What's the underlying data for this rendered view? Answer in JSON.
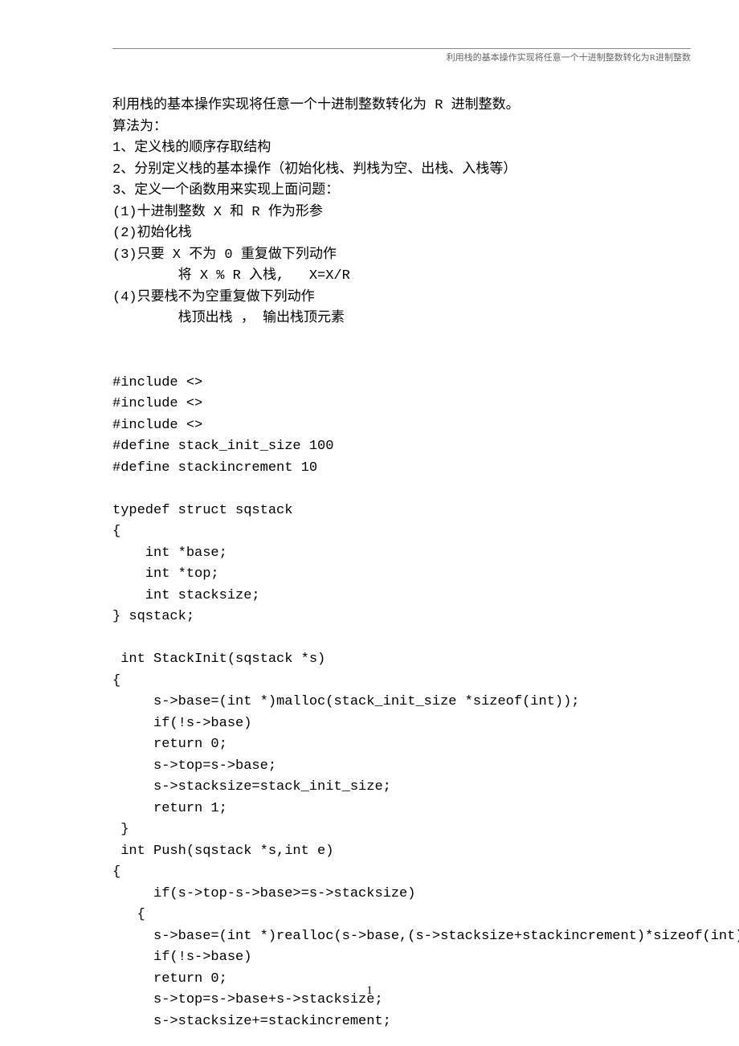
{
  "header": "利用栈的基本操作实现将任意一个十进制整数转化为R进制整数",
  "lines": [
    "利用栈的基本操作实现将任意一个十进制整数转化为 R 进制整数。",
    "算法为：",
    "1、定义栈的顺序存取结构",
    "2、分别定义栈的基本操作（初始化栈、判栈为空、出栈、入栈等）",
    "3、定义一个函数用来实现上面问题：",
    "(1)十进制整数 X 和 R 作为形参",
    "(2)初始化栈",
    "(3)只要 X 不为 0 重复做下列动作",
    "        将 X % R 入栈,   X=X/R",
    "(4)只要栈不为空重复做下列动作",
    "        栈顶出栈 ， 输出栈顶元素",
    "",
    "",
    "#include <>",
    "#include <>",
    "#include <>",
    "#define stack_init_size 100",
    "#define stackincrement 10",
    "",
    "typedef struct sqstack",
    "{",
    "    int *base;",
    "    int *top;",
    "    int stacksize;",
    "} sqstack;",
    "",
    " int StackInit(sqstack *s)",
    "{",
    "     s->base=(int *)malloc(stack_init_size *sizeof(int));",
    "     if(!s->base)",
    "     return 0;",
    "     s->top=s->base;",
    "     s->stacksize=stack_init_size;",
    "     return 1;",
    " }",
    " int Push(sqstack *s,int e)",
    "{",
    "     if(s->top-s->base>=s->stacksize)",
    "   {",
    "     s->base=(int *)realloc(s->base,(s->stacksize+stackincrement)*sizeof(int));",
    "     if(!s->base)",
    "     return 0;",
    "     s->top=s->base+s->stacksize;",
    "     s->stacksize+=stackincrement;"
  ],
  "pageNumber": "1"
}
